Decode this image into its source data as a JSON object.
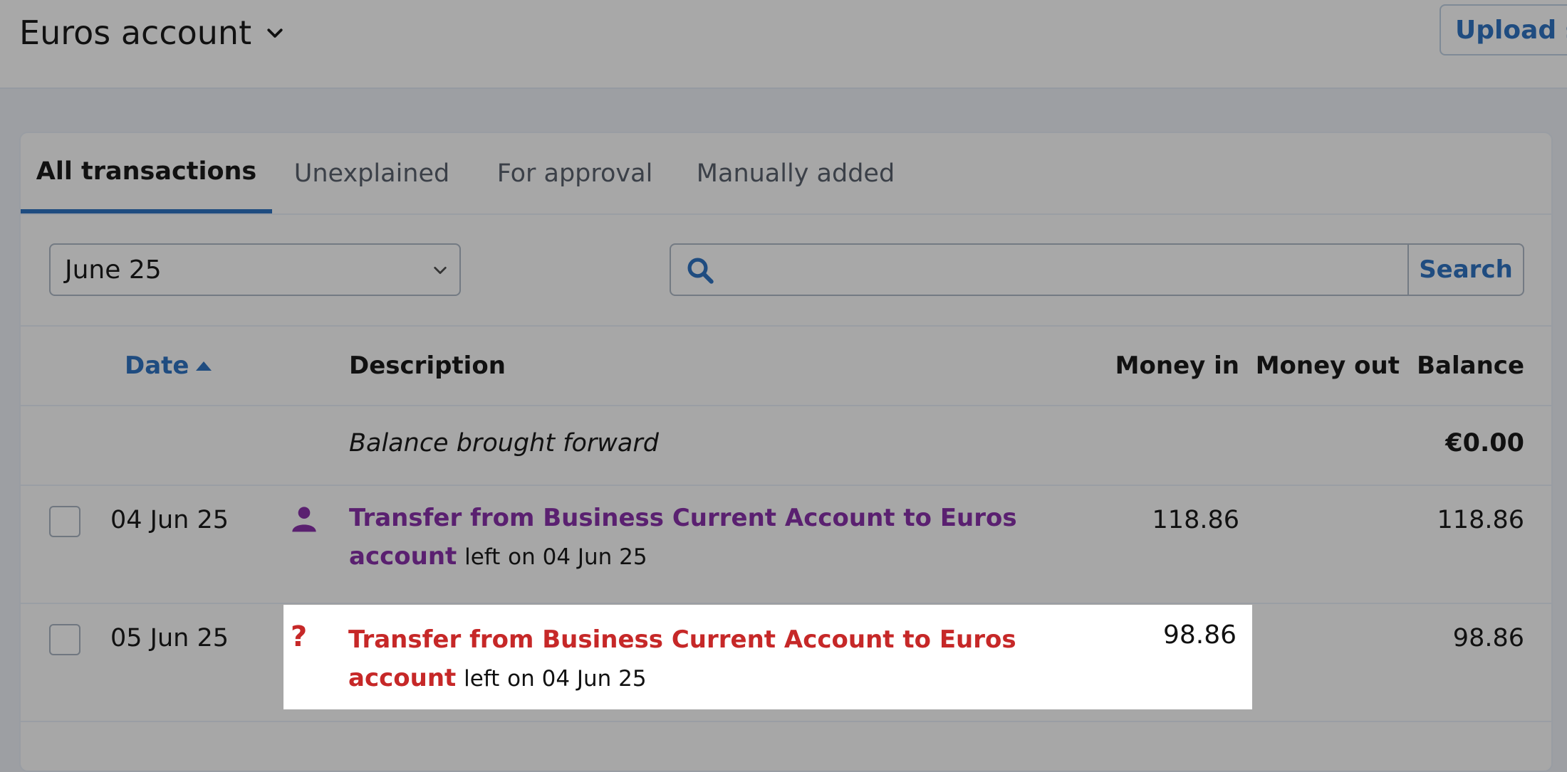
{
  "header": {
    "account_title": "Euros account",
    "upload_button": "Upload st"
  },
  "tabs": [
    {
      "label": "All transactions"
    },
    {
      "label": "Unexplained"
    },
    {
      "label": "For approval"
    },
    {
      "label": "Manually added"
    }
  ],
  "filters": {
    "period_value": "June 25",
    "search_placeholder": "",
    "search_button": "Search"
  },
  "table": {
    "headers": {
      "date": "Date",
      "description": "Description",
      "money_in": "Money in",
      "money_out": "Money out",
      "balance": "Balance"
    },
    "balance_forward": {
      "label": "Balance brought forward",
      "balance": "€0.00"
    },
    "rows": [
      {
        "date": "04 Jun 25",
        "icon": "user-icon",
        "title": "Transfer from Business Current Account to Euros account",
        "left_word": "left",
        "left_on": "on 04 Jun 25",
        "money_in": "118.86",
        "money_out": "",
        "balance": "118.86"
      },
      {
        "date": "05 Jun 25",
        "icon": "question-icon",
        "icon_glyph": "?",
        "title": "Transfer from Business Current Account to Euros account",
        "left_word": "left",
        "left_on": "on 04 Jun 25",
        "money_in": "98.86",
        "money_out": "",
        "balance": "98.86"
      }
    ]
  },
  "colors": {
    "accent_blue": "#1f4c80",
    "explained_purple": "#5a2070",
    "unexplained_red": "#c62828",
    "highlight_bg": "#ffffff"
  }
}
